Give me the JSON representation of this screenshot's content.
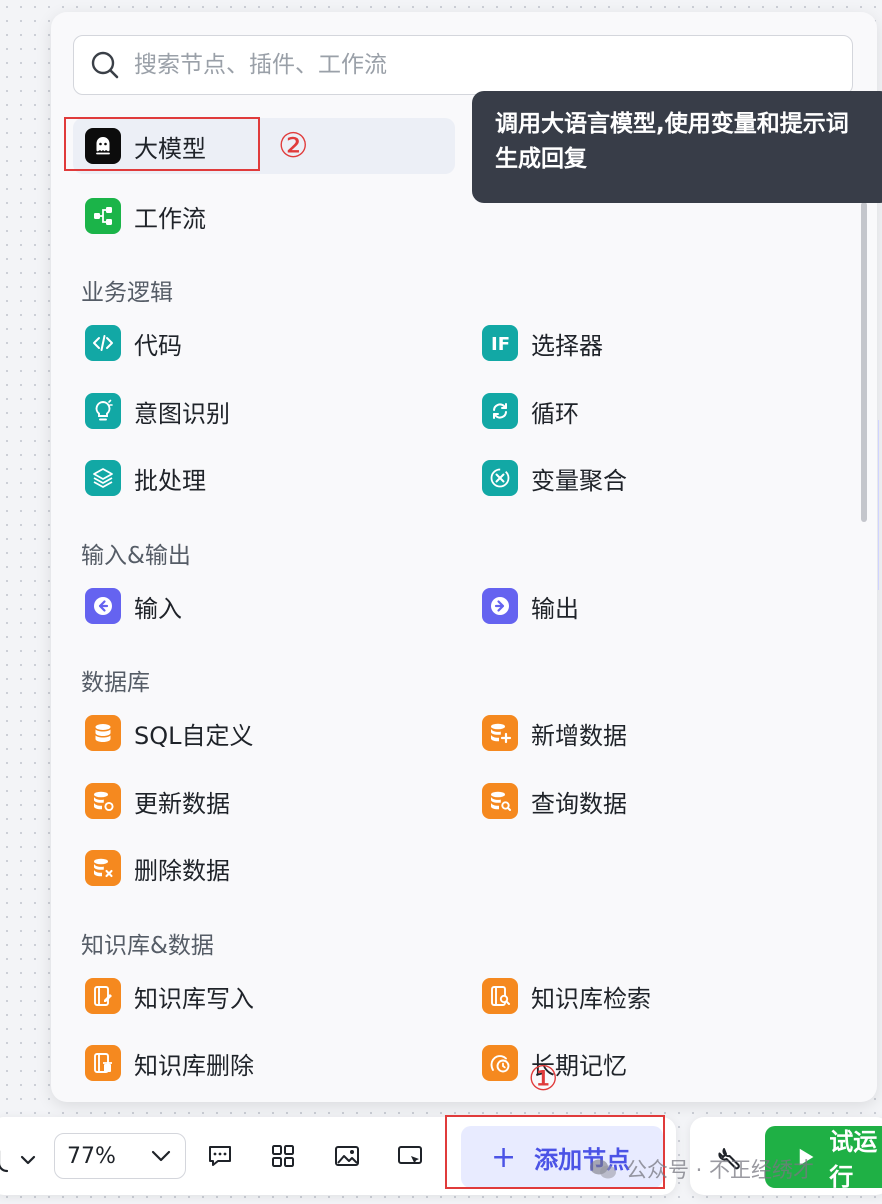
{
  "search": {
    "placeholder": "搜索节点、插件、工作流"
  },
  "top_items": [
    {
      "label": "大模型",
      "icon": "llm-ghost-icon",
      "color": "#0c0c0c"
    },
    {
      "label": "工作流",
      "icon": "workflow-share-icon",
      "color": "#1bb449"
    }
  ],
  "tooltip": {
    "line1": "调用大语言模型,使用变量和提示词",
    "line2": "生成回复"
  },
  "sections": [
    {
      "title": "业务逻辑",
      "items": [
        "代码",
        "选择器",
        "意图识别",
        "循环",
        "批处理",
        "变量聚合"
      ]
    },
    {
      "title": "输入&输出",
      "items": [
        "输入",
        "输出"
      ]
    },
    {
      "title": "数据库",
      "items": [
        "SQL自定义",
        "新增数据",
        "更新数据",
        "查询数据",
        "删除数据"
      ]
    },
    {
      "title": "知识库&数据",
      "items": [
        "知识库写入",
        "知识库检索",
        "知识库删除",
        "长期记忆"
      ]
    }
  ],
  "annotations": {
    "circle1": "①",
    "circle2": "②"
  },
  "toolbar": {
    "zoom": "77%",
    "add_node": "添加节点",
    "trial_run": "试运行",
    "watermark": "公众号 · 不正经绣才"
  },
  "colors": {
    "teal": "#12a8a5",
    "orange": "#f5891f",
    "indigo": "#6563f0",
    "accent": "#4b53e6",
    "green": "#1fb045",
    "annotation_red": "#e03b3b"
  }
}
